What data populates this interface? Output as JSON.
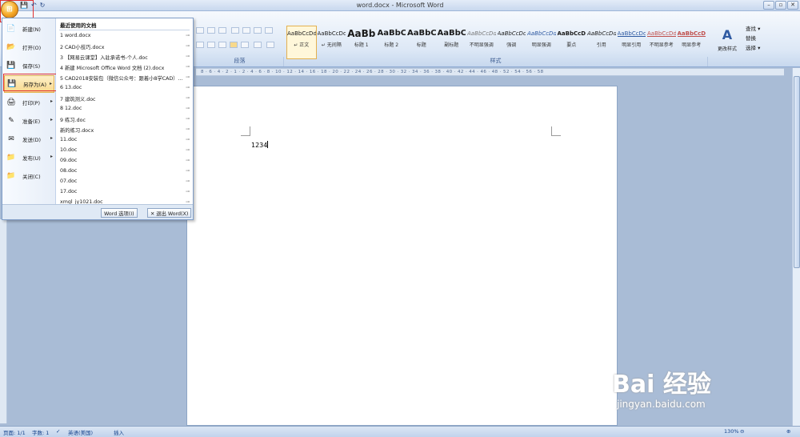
{
  "window": {
    "title": "word.docx - Microsoft Word"
  },
  "quick_access": {
    "save": "💾",
    "undo": "↶",
    "redo": "↻"
  },
  "ribbon": {
    "groups": [
      "段落",
      "样式"
    ],
    "styles": [
      {
        "preview": "AaBbCcDd",
        "name": "↵ 正文",
        "selected": true
      },
      {
        "preview": "AaBbCcDd",
        "name": "↵ 无间隔"
      },
      {
        "preview": "AaBb",
        "name": "标题 1",
        "size": "big"
      },
      {
        "preview": "AaBbC",
        "name": "标题 2",
        "size": "med"
      },
      {
        "preview": "AaBbC",
        "name": "标题",
        "size": "med"
      },
      {
        "preview": "AaBbC",
        "name": "副标题",
        "size": "med"
      },
      {
        "preview": "AaBbCcDd",
        "name": "不明显强调"
      },
      {
        "preview": "AaBbCcDd",
        "name": "强调"
      },
      {
        "preview": "AaBbCcDd",
        "name": "明显强调"
      },
      {
        "preview": "AaBbCcDd",
        "name": "要点"
      },
      {
        "preview": "AaBbCcDd",
        "name": "引用"
      },
      {
        "preview": "AaBbCcDd",
        "name": "明显引用"
      },
      {
        "preview": "AaBbCcDd",
        "name": "不明显参考"
      },
      {
        "preview": "AaBbCcDd",
        "name": "明显参考"
      }
    ],
    "change_styles": "更改样式",
    "editing": [
      "查找 ▾",
      "替换",
      "选择 ▾"
    ]
  },
  "office_menu": {
    "commands": [
      {
        "label": "新建(N)",
        "icon": "📄"
      },
      {
        "label": "打开(O)",
        "icon": "📂"
      },
      {
        "label": "保存(S)",
        "icon": "💾"
      },
      {
        "label": "另存为(A)",
        "icon": "💾",
        "arrow": "▸"
      },
      {
        "label": "打印(P)",
        "icon": "🖨",
        "arrow": "▸"
      },
      {
        "label": "准备(E)",
        "icon": "✎",
        "arrow": "▸"
      },
      {
        "label": "发送(D)",
        "icon": "✉",
        "arrow": "▸"
      },
      {
        "label": "发布(U)",
        "icon": "📁",
        "arrow": "▸"
      },
      {
        "label": "关闭(C)",
        "icon": "📁"
      }
    ],
    "recent_title": "最近使用的文档",
    "recent_docs": [
      "1 word.docx",
      "2 CAD小技巧.docx",
      "3 【网易云课堂】入驻承诺书-个人.doc",
      "4 新建 Microsoft Office Word 文档 (2).docx",
      "5 CAD2018安装包（微信公众号：跟着小8学CAD）...",
      "6 13.doc",
      "7 建筑测义.doc",
      "8 12.doc",
      "9 练习.doc",
      "新的练习.docx",
      "11.doc",
      "10.doc",
      "09.doc",
      "08.doc",
      "07.doc",
      "17.doc",
      "xmgl_jy1021.doc"
    ],
    "pin": "⊸",
    "word_options": "Word 选项(I)",
    "exit_word": "✕ 退出 Word(X)"
  },
  "document": {
    "text": "1234"
  },
  "ruler": {
    "text": "8 · 6 · 4 · 2 · 1 · 2 · 4 · 6 · 8 · 10 · 12 · 14 · 16 · 18 · 20 · 22 · 24 · 26 · 28 · 30 · 32 · 34 · 36 · 38 · 40 · 42 · 44 · 46 · 48 · 52 · 54 · 56 · 58"
  },
  "status": {
    "page": "页面: 1/1",
    "words": "字数: 1",
    "lang": "英语(美国)",
    "mode": "插入",
    "zoom": "130%"
  },
  "watermark": {
    "logo": "Bai 经验",
    "url": "jingyan.baidu.com"
  }
}
